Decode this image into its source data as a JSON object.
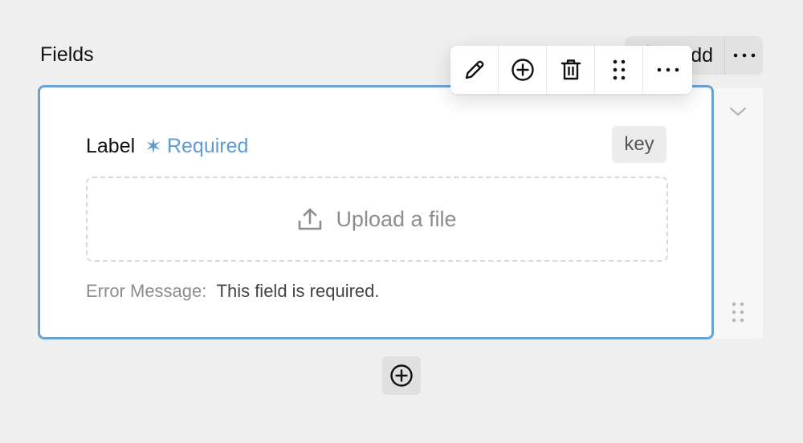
{
  "section": {
    "title": "Fields"
  },
  "add_menu": {
    "add_label": "Add",
    "more_icon": "ellipsis-icon"
  },
  "field_card": {
    "label": "Label",
    "required_text": "Required",
    "required_symbol": "✶",
    "key_badge": "key",
    "upload": {
      "text": "Upload a file",
      "icon": "upload-icon"
    },
    "error": {
      "label": "Error Message:",
      "message": "This field is required."
    }
  },
  "toolbar": {
    "items": [
      {
        "name": "edit",
        "icon": "pencil-icon"
      },
      {
        "name": "add",
        "icon": "plus-circle-icon"
      },
      {
        "name": "delete",
        "icon": "trash-icon"
      },
      {
        "name": "drag",
        "icon": "drag-handle-icon"
      },
      {
        "name": "more",
        "icon": "ellipsis-icon"
      }
    ]
  },
  "side_panel": {
    "collapse_icon": "chevron-down-icon",
    "drag_icon": "drag-handle-icon"
  },
  "add_below": {
    "icon": "plus-circle-icon"
  },
  "colors": {
    "accent": "#5b9bd5",
    "card_border": "#6aa2d6",
    "muted_text": "#8d8d8d",
    "background": "#efefef"
  }
}
